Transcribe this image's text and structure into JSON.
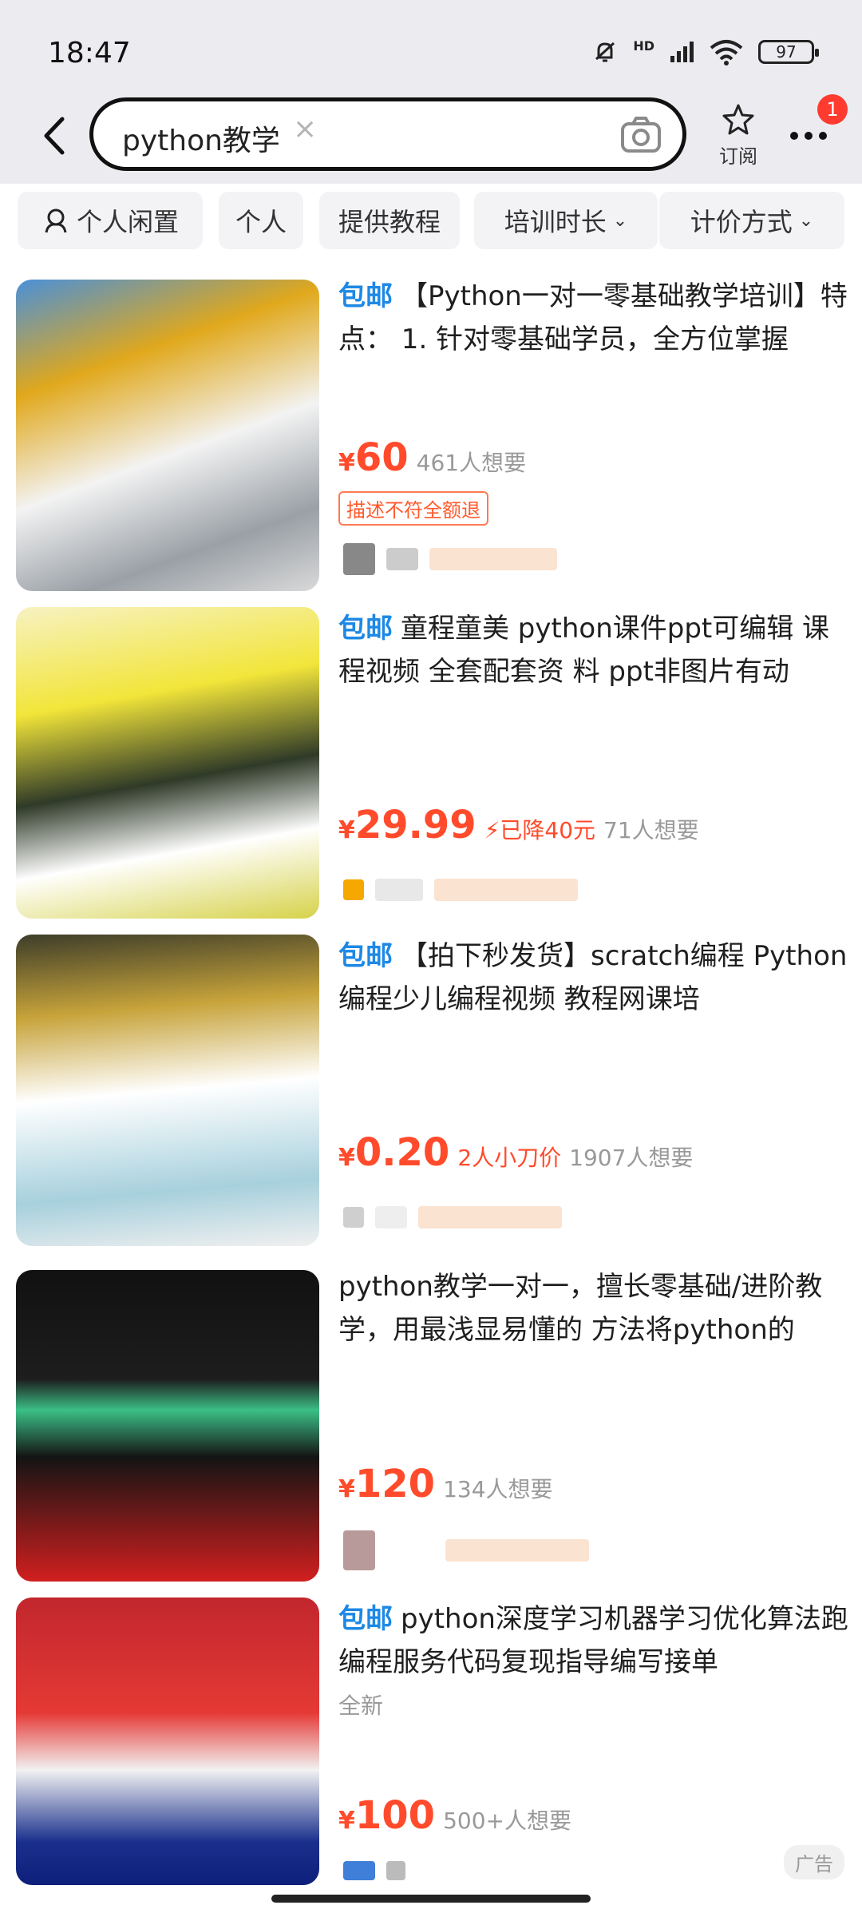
{
  "status": {
    "time": "18:47",
    "battery": "97",
    "network": "HD"
  },
  "search": {
    "query": "python教学",
    "clear": "×"
  },
  "header": {
    "subscribe_label": "订阅",
    "notification_count": "1"
  },
  "filters": [
    {
      "label": "个人闲置",
      "has_icon": true
    },
    {
      "label": "个人"
    },
    {
      "label": "提供教程"
    },
    {
      "label": "培训时长",
      "dropdown": true
    },
    {
      "label": "计价方式",
      "dropdown": true
    }
  ],
  "chevron": "⌄",
  "yen": "¥",
  "items": [
    {
      "free_shipping": "包邮",
      "title": "【Python一对一零基础教学培训】特点： 1. 针对零基础学员，全方位掌握",
      "price": "60",
      "want": "461人想要",
      "refund_tag": "描述不符全额退"
    },
    {
      "free_shipping": "包邮",
      "title": "童程童美 python课件ppt可编辑 课程视频 全套配套资 料 ppt非图片有动",
      "price": "29.99",
      "price_drop": "已降40元",
      "want": "71人想要"
    },
    {
      "free_shipping": "包邮",
      "title": "【拍下秒发货】scratch编程 Python编程少儿编程视频 教程网课培",
      "price": "0.20",
      "bargain": "2人小刀价",
      "want": "1907人想要"
    },
    {
      "title": "python教学一对一，擅长零基础/进阶教学，用最浅显易懂的 方法将python的",
      "price": "120",
      "want": "134人想要"
    },
    {
      "free_shipping": "包邮",
      "title": "python深度学习机器学习优化算法跑编程服务代码复现指导编写接单",
      "condition": "全新",
      "price": "100",
      "want": "500+人想要"
    }
  ],
  "ad_label": "广告",
  "colors": {
    "accent_red": "#ff4b2b",
    "free_blue": "#1e88e5",
    "header_bg": "#ececf0"
  }
}
